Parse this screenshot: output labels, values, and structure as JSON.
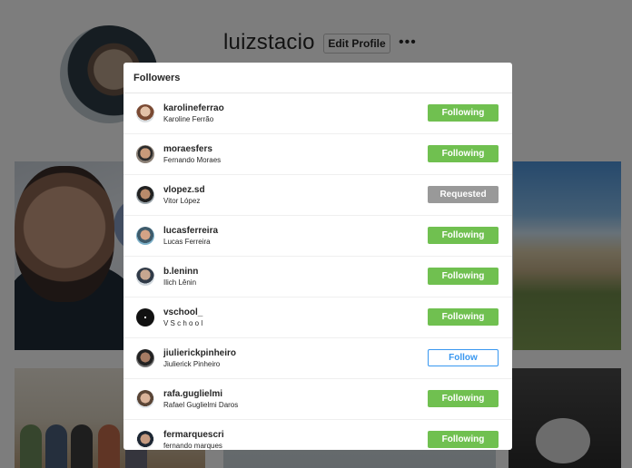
{
  "profile": {
    "username": "luizstacio",
    "edit_profile_label": "Edit Profile",
    "more_options": "•••",
    "avatar_icon": "profile-avatar"
  },
  "modal": {
    "title": "Followers",
    "followers": [
      {
        "handle": "karolineferrao",
        "name": "Karoline Ferrão",
        "button": "Following",
        "state": "following"
      },
      {
        "handle": "moraesfers",
        "name": "Fernando Moraes",
        "button": "Following",
        "state": "following"
      },
      {
        "handle": "vlopez.sd",
        "name": "Vitor López",
        "button": "Requested",
        "state": "requested"
      },
      {
        "handle": "lucasferreira",
        "name": "Lucas Ferreira",
        "button": "Following",
        "state": "following"
      },
      {
        "handle": "b.leninn",
        "name": "Ilich Lênin",
        "button": "Following",
        "state": "following"
      },
      {
        "handle": "vschool_",
        "name": "V S c h o o l",
        "button": "Following",
        "state": "following"
      },
      {
        "handle": "jiulierickpinheiro",
        "name": "Jiulierick Pinheiro",
        "button": "Follow",
        "state": "follow"
      },
      {
        "handle": "rafa.guglielmi",
        "name": "Rafael Guglielmi Daros",
        "button": "Following",
        "state": "following"
      },
      {
        "handle": "fermarquescri",
        "name": "fernando marques",
        "button": "Following",
        "state": "following"
      }
    ]
  },
  "colors": {
    "following": "#70c050",
    "requested": "#999999",
    "follow_border": "#3897f0",
    "overlay": "rgba(0,0,0,0.5)"
  }
}
